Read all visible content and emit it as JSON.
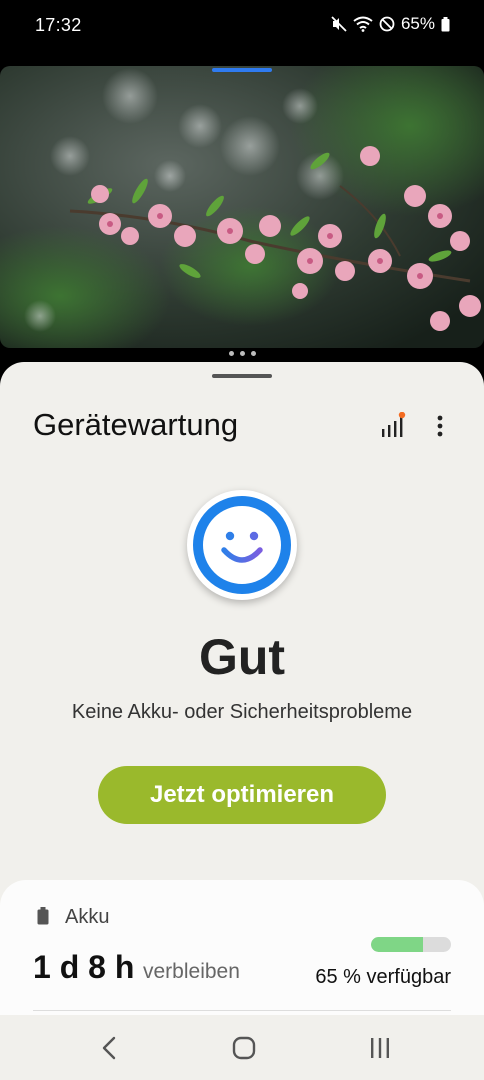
{
  "status_bar": {
    "time": "17:32",
    "battery_percent": "65%",
    "icons": [
      "mute-icon",
      "wifi-icon",
      "do-not-disturb-icon",
      "battery-icon"
    ]
  },
  "top_window": {
    "content": "cherry-blossom-photo"
  },
  "app": {
    "title": "Gerätewartung",
    "header_icons": [
      "stats-icon",
      "more-options-icon"
    ]
  },
  "status": {
    "icon": "smiley-face-icon",
    "title": "Gut",
    "subtitle": "Keine Akku- oder Sicherheitsprobleme"
  },
  "optimize_button": {
    "label": "Jetzt optimieren"
  },
  "battery": {
    "label": "Akku",
    "time_remaining": "1 d 8 h",
    "remaining_label": "verbleiben",
    "available": "65 % verfügbar",
    "level": 0.65
  },
  "nav": {
    "icons": [
      "back-icon",
      "home-icon",
      "recents-icon"
    ]
  },
  "colors": {
    "accent_button": "#9ab92c",
    "face_ring": "#1e82ea",
    "battery_fill": "#7fd686",
    "split_handle": "#2f7bf0"
  }
}
